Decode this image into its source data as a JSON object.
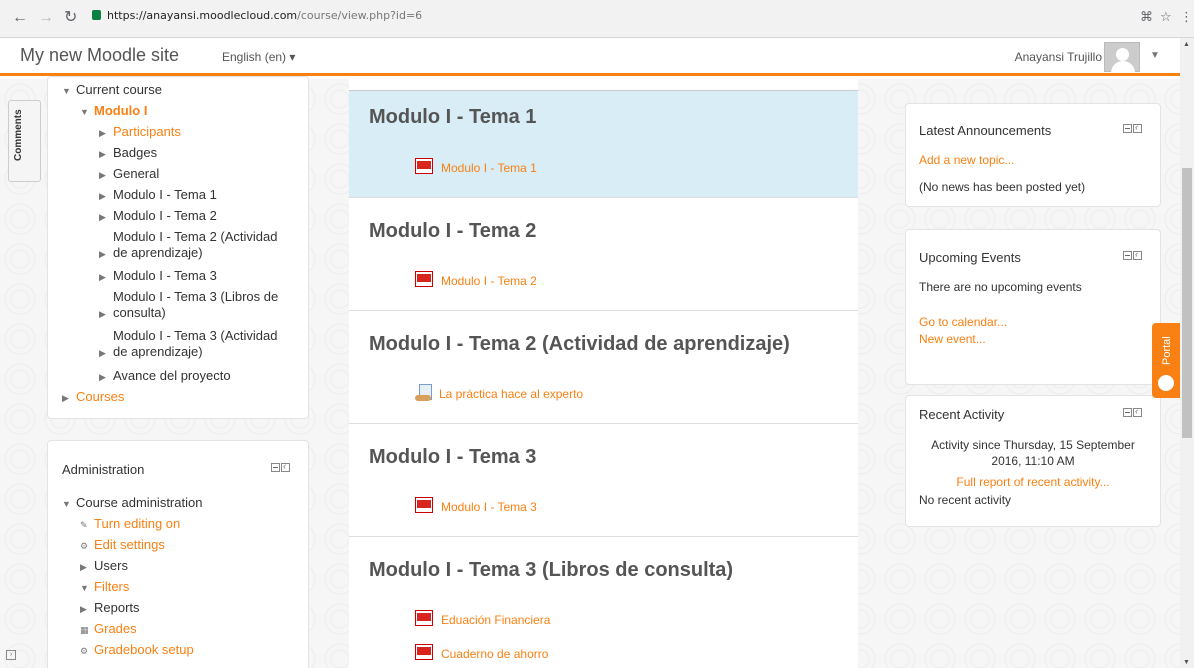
{
  "browser": {
    "url_host": "https://anayansi.moodlecloud.com",
    "url_path": "/course/view.php?id=6"
  },
  "navbar": {
    "site_name": "My new Moodle site",
    "language": "English (en) ▾",
    "user_name": "Anayansi Trujillo"
  },
  "comments_tab": "Comments",
  "navigation": {
    "current_course": "Current course",
    "course": "Modulo I",
    "items": [
      "Participants",
      "Badges",
      "General",
      "Modulo I - Tema 1",
      "Modulo I - Tema 2",
      "Modulo I - Tema 2 (Actividad de aprendizaje)",
      "Modulo I - Tema 3",
      "Modulo I - Tema 3 (Libros de consulta)",
      "Modulo I - Tema 3 (Actividad de aprendizaje)",
      "Avance del proyecto"
    ],
    "courses": "Courses"
  },
  "administration": {
    "title": "Administration",
    "course_admin": "Course administration",
    "items": [
      "Turn editing on",
      "Edit settings",
      "Users",
      "Filters",
      "Reports",
      "Grades",
      "Gradebook setup"
    ]
  },
  "sections": [
    {
      "title": "Modulo I - Tema 1",
      "activities": [
        "Modulo I - Tema 1"
      ]
    },
    {
      "title": "Modulo I - Tema 2",
      "activities": [
        "Modulo I - Tema 2"
      ]
    },
    {
      "title": "Modulo I - Tema 2 (Actividad de aprendizaje)",
      "activities": [
        "La práctica hace al experto"
      ]
    },
    {
      "title": "Modulo I - Tema 3",
      "activities": [
        "Modulo I - Tema 3"
      ]
    },
    {
      "title": "Modulo I - Tema 3 (Libros de consulta)",
      "activities": [
        "Eduación Financiera",
        "Cuaderno de ahorro"
      ]
    }
  ],
  "announcements": {
    "title": "Latest Announcements",
    "add_topic": "Add a new topic...",
    "empty": "(No news has been posted yet)"
  },
  "events": {
    "title": "Upcoming Events",
    "empty": "There are no upcoming events",
    "calendar": "Go to calendar...",
    "new_event": "New event..."
  },
  "recent": {
    "title": "Recent Activity",
    "since": "Activity since Thursday, 15 September 2016, 11:10 AM",
    "full_report": "Full report of recent activity...",
    "empty": "No recent activity"
  },
  "portal_tab": "Portal",
  "colors": {
    "accent": "#f98012",
    "highlight": "#d9edf7"
  }
}
